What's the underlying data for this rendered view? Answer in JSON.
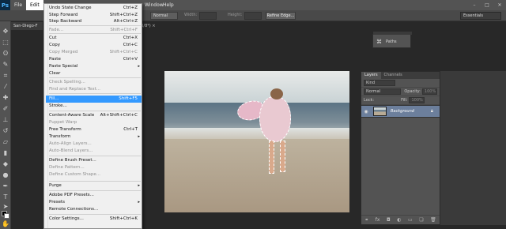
{
  "app": {
    "logo": "Ps"
  },
  "menubar": {
    "items": [
      "File",
      "Edit"
    ],
    "window": "Window",
    "help": "Help"
  },
  "window_controls": [
    "minimize-icon",
    "maximize-icon",
    "close-icon"
  ],
  "options_bar": {
    "style_value": "Normal",
    "width_label": "Width:",
    "height_label": "Height:",
    "refine_edge": "Refine Edge...",
    "workspace": "Essentials"
  },
  "document": {
    "tab_label": "San-Diego-F",
    "tab_suffix": "B/8*) ×"
  },
  "edit_menu": [
    {
      "label": "Undo State Change",
      "shortcut": "Ctrl+Z",
      "enabled": true
    },
    {
      "label": "Step Forward",
      "shortcut": "Shift+Ctrl+Z",
      "enabled": true
    },
    {
      "label": "Step Backward",
      "shortcut": "Alt+Ctrl+Z",
      "enabled": true
    },
    {
      "label": "Fade...",
      "shortcut": "Shift+Ctrl+F",
      "enabled": false
    },
    {
      "label": "Cut",
      "shortcut": "Ctrl+X",
      "enabled": true
    },
    {
      "label": "Copy",
      "shortcut": "Ctrl+C",
      "enabled": true
    },
    {
      "label": "Copy Merged",
      "shortcut": "Shift+Ctrl+C",
      "enabled": false
    },
    {
      "label": "Paste",
      "shortcut": "Ctrl+V",
      "enabled": true
    },
    {
      "label": "Paste Special",
      "shortcut": "",
      "enabled": true,
      "submenu": true
    },
    {
      "label": "Clear",
      "shortcut": "",
      "enabled": true
    },
    {
      "label": "Check Spelling...",
      "shortcut": "",
      "enabled": false
    },
    {
      "label": "Find and Replace Text...",
      "shortcut": "",
      "enabled": false
    },
    {
      "label": "Fill...",
      "shortcut": "Shift+F5",
      "enabled": true,
      "highlighted": true
    },
    {
      "label": "Stroke...",
      "shortcut": "",
      "enabled": true
    },
    {
      "label": "Content-Aware Scale",
      "shortcut": "Alt+Shift+Ctrl+C",
      "enabled": true
    },
    {
      "label": "Puppet Warp",
      "shortcut": "",
      "enabled": false
    },
    {
      "label": "Free Transform",
      "shortcut": "Ctrl+T",
      "enabled": true
    },
    {
      "label": "Transform",
      "shortcut": "",
      "enabled": true,
      "submenu": true
    },
    {
      "label": "Auto-Align Layers...",
      "shortcut": "",
      "enabled": false
    },
    {
      "label": "Auto-Blend Layers...",
      "shortcut": "",
      "enabled": false
    },
    {
      "label": "Define Brush Preset...",
      "shortcut": "",
      "enabled": true
    },
    {
      "label": "Define Pattern...",
      "shortcut": "",
      "enabled": false
    },
    {
      "label": "Define Custom Shape...",
      "shortcut": "",
      "enabled": false
    },
    {
      "label": "Purge",
      "shortcut": "",
      "enabled": true,
      "submenu": true
    },
    {
      "label": "Adobe PDF Presets...",
      "shortcut": "",
      "enabled": true
    },
    {
      "label": "Presets",
      "shortcut": "",
      "enabled": true,
      "submenu": true
    },
    {
      "label": "Remote Connections...",
      "shortcut": "",
      "enabled": true
    },
    {
      "label": "Color Settings...",
      "shortcut": "Shift+Ctrl+K",
      "enabled": true
    }
  ],
  "paths_panel": {
    "label": "Paths"
  },
  "layers_panel": {
    "tabs": [
      "Layers",
      "Channels"
    ],
    "filter_kind": "Kind",
    "blend_mode": "Normal",
    "opacity_label": "Opacity:",
    "opacity_value": "100%",
    "lock_label": "Lock:",
    "fill_label": "Fill:",
    "fill_value": "100%",
    "layer_name": "Background",
    "footer_icons": [
      "link-icon",
      "fx-icon",
      "mask-icon",
      "adjustment-icon",
      "folder-icon",
      "new-layer-icon",
      "trash-icon"
    ]
  }
}
